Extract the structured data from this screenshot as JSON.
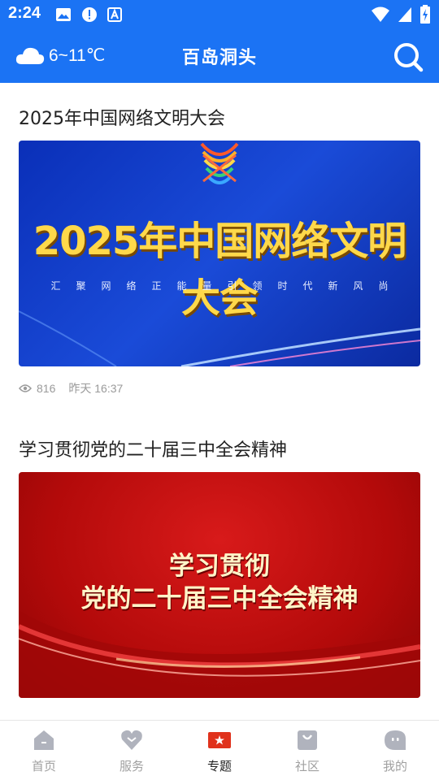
{
  "status_bar": {
    "time": "2:24",
    "icons": [
      "image-icon",
      "alert-icon",
      "a-icon"
    ],
    "system_icons": [
      "wifi-icon",
      "signal-icon",
      "battery-charging-icon"
    ]
  },
  "app_bar": {
    "weather": {
      "icon": "cloud-icon",
      "text": "6~11℃"
    },
    "title": "百岛洞头",
    "search_icon": "search-icon",
    "background": "#1b73f4"
  },
  "feed": {
    "items": [
      {
        "title": "2025年中国网络文明大会",
        "banner": {
          "headline": "2025年中国网络文明大会",
          "subline": "汇聚网络正能量引领时代新风尚"
        },
        "views": "816",
        "time": "昨天 16:37"
      },
      {
        "title": "学习贯彻党的二十届三中全会精神",
        "banner": {
          "line1": "学习贯彻",
          "line2": "党的二十届三中全会精神"
        }
      }
    ]
  },
  "tab_bar": {
    "tabs": [
      {
        "label": "首页",
        "icon": "home-icon",
        "active": false
      },
      {
        "label": "服务",
        "icon": "heart-icon",
        "active": false
      },
      {
        "label": "专题",
        "icon": "star-badge-icon",
        "active": true
      },
      {
        "label": "社区",
        "icon": "bag-icon",
        "active": false
      },
      {
        "label": "我的",
        "icon": "profile-icon",
        "active": false
      }
    ],
    "active_color": "#e0321c",
    "inactive_color": "#a0a0a0"
  }
}
